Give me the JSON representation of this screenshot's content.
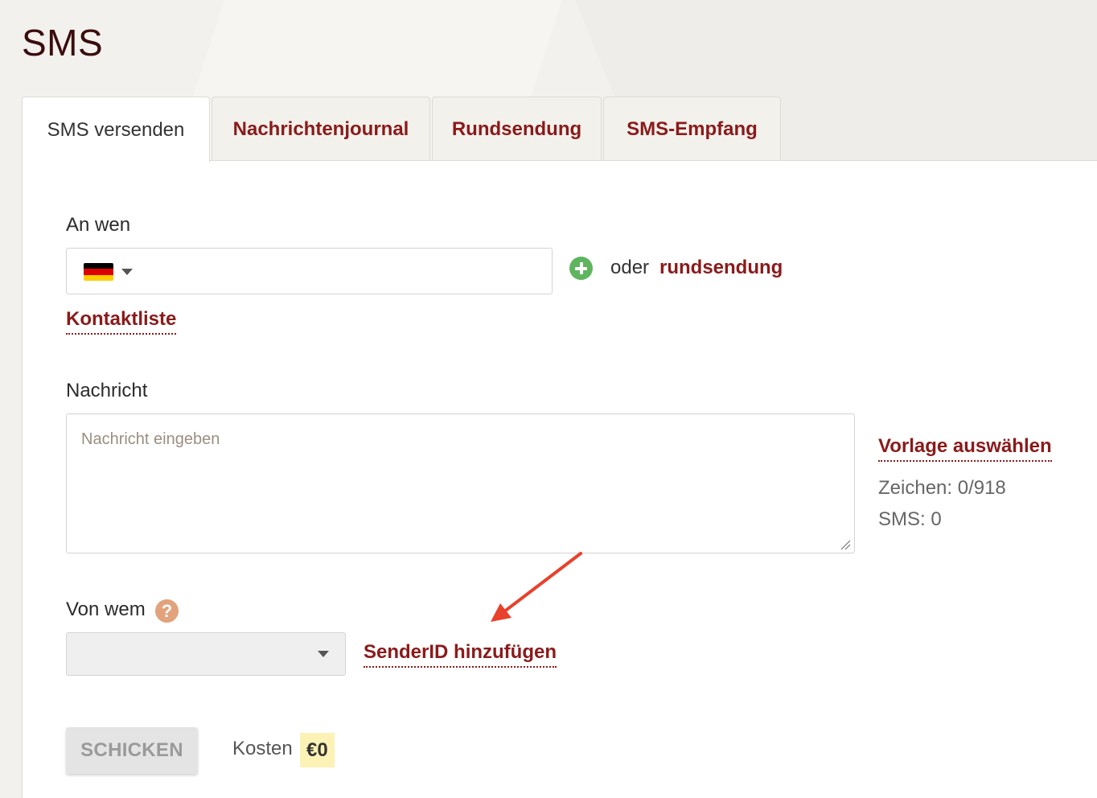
{
  "page": {
    "title": "SMS"
  },
  "tabs": [
    {
      "label": "SMS versenden",
      "active": true
    },
    {
      "label": "Nachrichtenjournal",
      "active": false
    },
    {
      "label": "Rundsendung",
      "active": false
    },
    {
      "label": "SMS-Empfang",
      "active": false
    }
  ],
  "recipient": {
    "label": "An wen",
    "country_flag": "flag-germany-icon",
    "phone_value": "",
    "or_text": "oder",
    "broadcast_link": "rundsendung",
    "contact_list_link": "Kontaktliste"
  },
  "message": {
    "label": "Nachricht",
    "value": "",
    "placeholder": "Nachricht eingeben",
    "template_link": "Vorlage auswählen",
    "chars_text": "Zeichen: 0/918",
    "sms_count_text": "SMS: 0"
  },
  "sender": {
    "label": "Von wem",
    "help_icon": "?",
    "selected_value": "",
    "add_sender_link": "SenderID hinzufügen"
  },
  "footer": {
    "send_label": "SCHICKEN",
    "cost_label": "Kosten",
    "cost_value": "€0"
  },
  "colors": {
    "accent": "#8b1a1a",
    "add_icon": "#5fb55f",
    "help_icon": "#e2a27c",
    "price_highlight": "#fdf2b6",
    "annotation_arrow": "#e8412c"
  }
}
